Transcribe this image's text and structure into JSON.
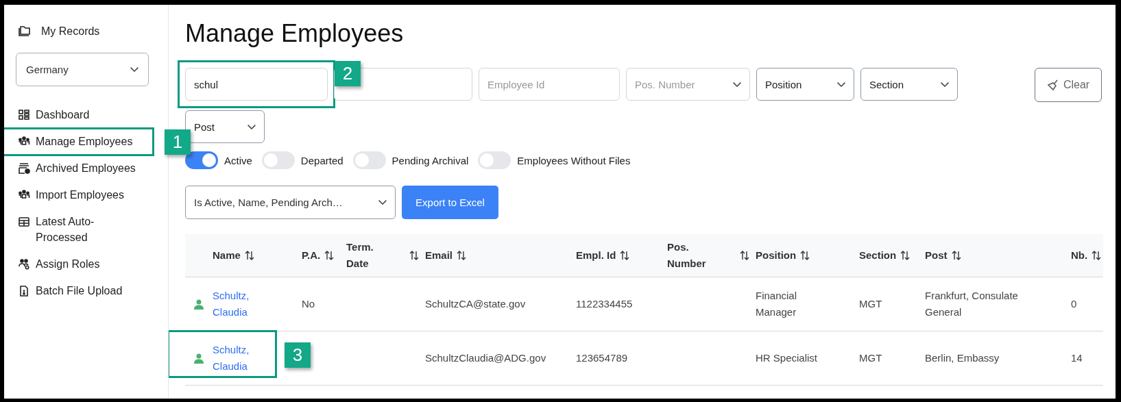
{
  "sidebar": {
    "header": {
      "label": "My Records"
    },
    "country_select": {
      "value": "Germany"
    },
    "items": [
      {
        "label": "Dashboard",
        "kind": "dashboard"
      },
      {
        "label": "Manage Employees",
        "kind": "people",
        "callout": "1"
      },
      {
        "label": "Archived Employees",
        "kind": "archive"
      },
      {
        "label": "Import Employees",
        "kind": "people"
      },
      {
        "label": "Latest Auto-Processed",
        "kind": "table"
      },
      {
        "label": "Assign Roles",
        "kind": "roles"
      },
      {
        "label": "Batch File Upload",
        "kind": "file"
      }
    ]
  },
  "page_title": "Manage Employees",
  "filters": [
    {
      "kind": "text",
      "value": "schul",
      "callout": "2"
    },
    {
      "kind": "text"
    },
    {
      "kind": "text",
      "placeholder": "Employee Id"
    },
    {
      "kind": "select",
      "placeholder": "Pos. Number"
    },
    {
      "kind": "select",
      "value": "Position"
    },
    {
      "kind": "select",
      "value": "Section"
    },
    {
      "kind": "select",
      "value": "Post"
    }
  ],
  "clear_button": "Clear",
  "toggles": [
    {
      "label": "Active",
      "on": true
    },
    {
      "label": "Departed",
      "on": false
    },
    {
      "label": "Pending Archival",
      "on": false
    },
    {
      "label": "Employees Without Files",
      "on": false
    }
  ],
  "columns_select": {
    "value": "Is Active, Name, Pending Arch…"
  },
  "export_button": "Export to Excel",
  "table": {
    "columns": [
      "Name",
      "P.A.",
      "Term. Date",
      "Email",
      "Empl. Id",
      "Pos. Number",
      "Position",
      "Section",
      "Post",
      "Nb."
    ],
    "rows": [
      {
        "cells": [
          "Schultz, Claudia",
          "No",
          null,
          "SchultzCA@state.gov",
          "1122334455",
          null,
          "Financial Manager",
          "MGT",
          "Frankfurt, Consulate General",
          "0"
        ]
      },
      {
        "cells": [
          "Schultz, Claudia",
          null,
          null,
          "SchultzClaudia@ADG.gov",
          "123654789",
          null,
          "HR Specialist",
          "MGT",
          "Berlin, Embassy",
          "14"
        ],
        "callout": "3"
      }
    ]
  }
}
